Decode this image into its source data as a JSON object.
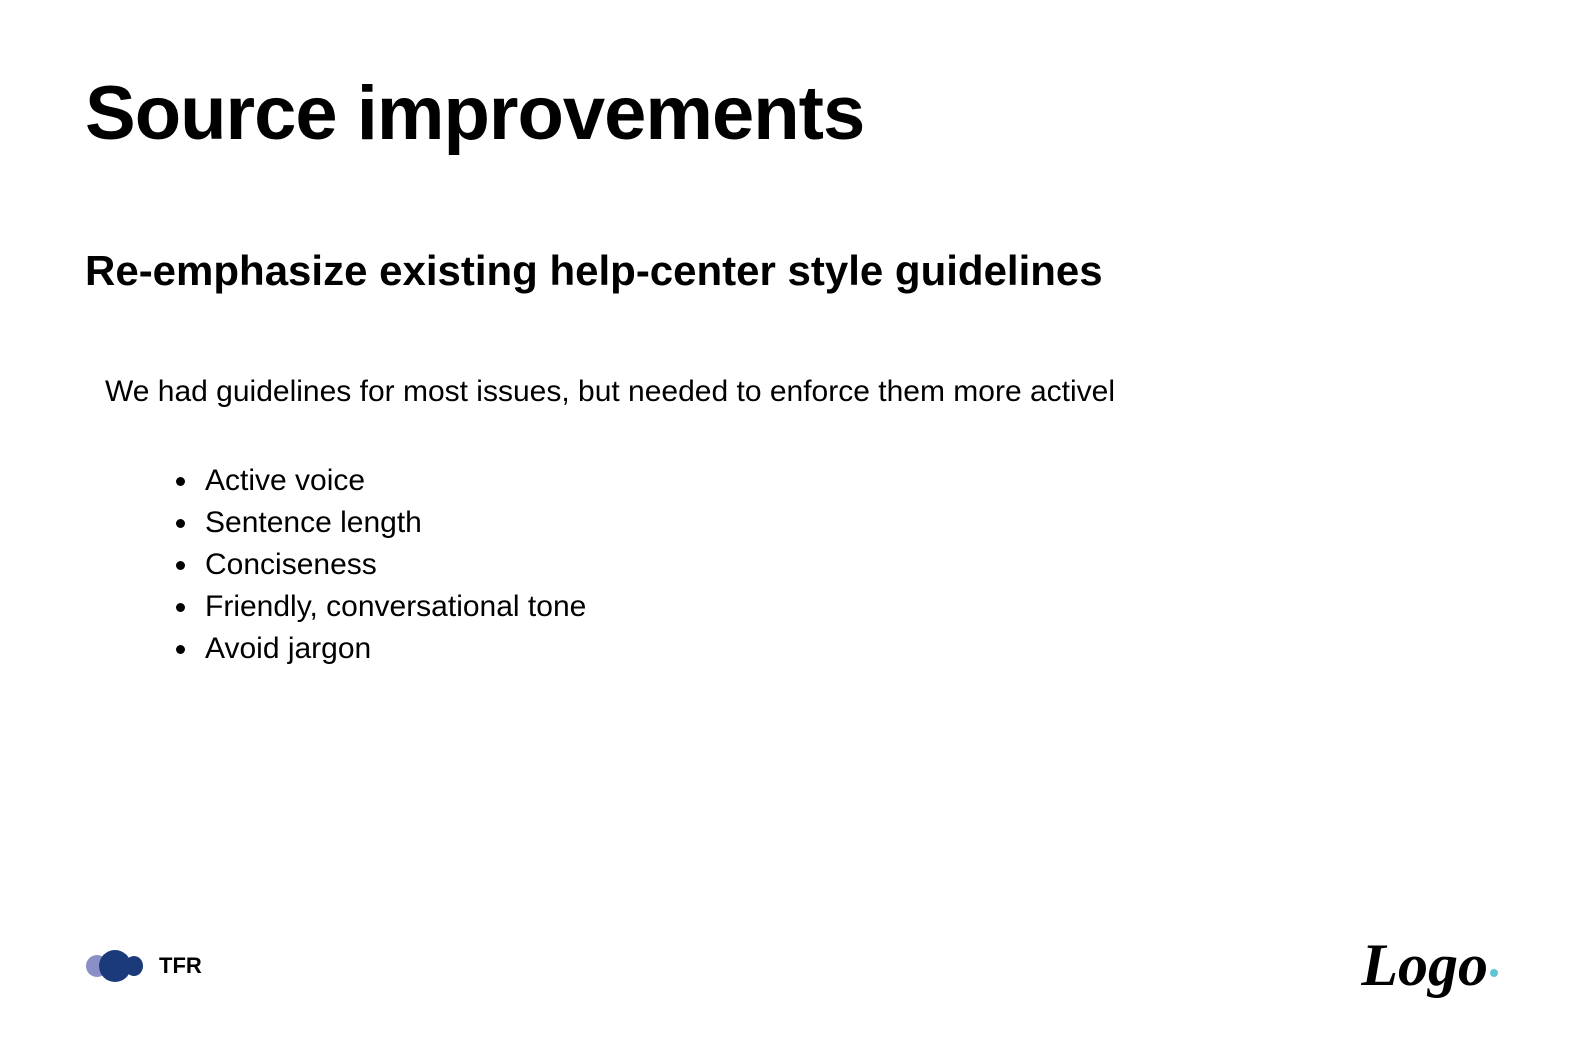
{
  "slide": {
    "title": "Source improvements",
    "subtitle": "Re-emphasize existing help-center style guidelines",
    "intro": "We had guidelines for most issues, but needed to enforce them more activel",
    "bullets": [
      "Active voice",
      "Sentence length",
      "Conciseness",
      "Friendly, conversational tone",
      "Avoid jargon"
    ]
  },
  "footer": {
    "left_label": "TFR",
    "right_label": "Logo"
  }
}
